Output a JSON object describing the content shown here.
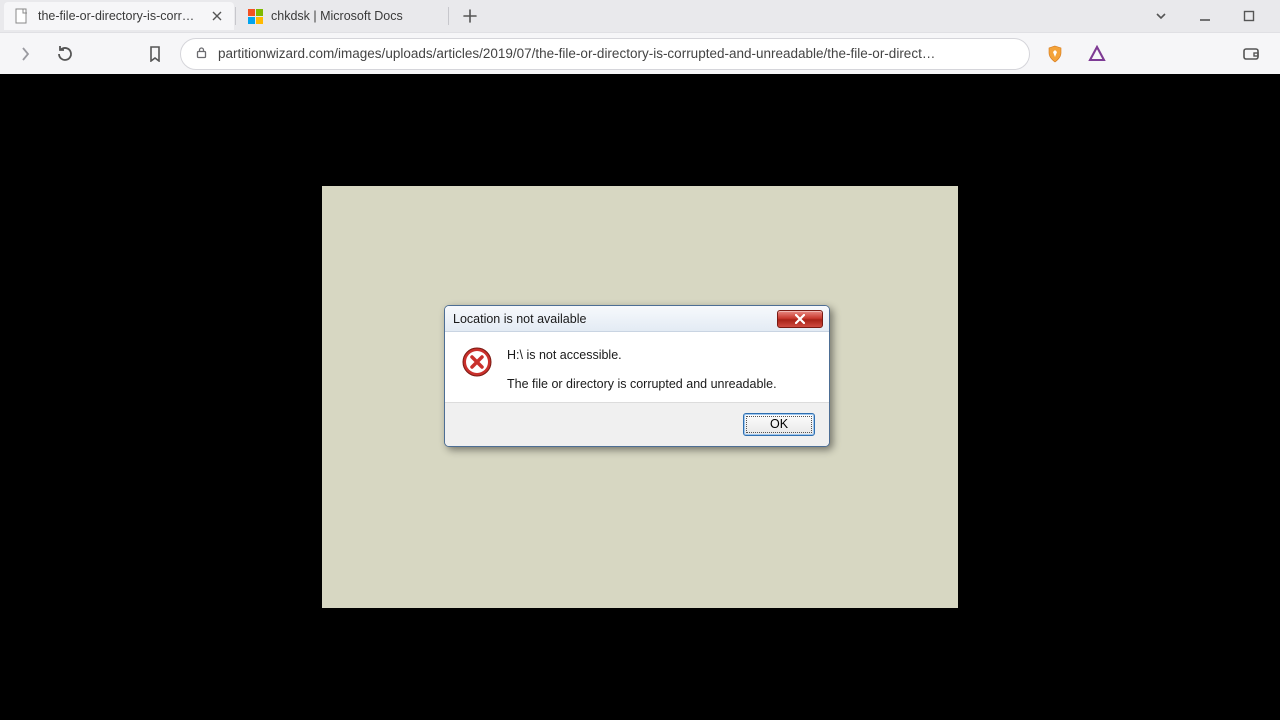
{
  "tabs": [
    {
      "title": "the-file-or-directory-is-corrupted",
      "active": true
    },
    {
      "title": "chkdsk | Microsoft Docs",
      "active": false
    }
  ],
  "toolbar": {
    "url": "partitionwizard.com/images/uploads/articles/2019/07/the-file-or-directory-is-corrupted-and-unreadable/the-file-or-direct…"
  },
  "dialog": {
    "title": "Location is not available",
    "line1": "H:\\ is not accessible.",
    "line2": "The file or directory is corrupted and unreadable.",
    "ok_label": "OK"
  }
}
